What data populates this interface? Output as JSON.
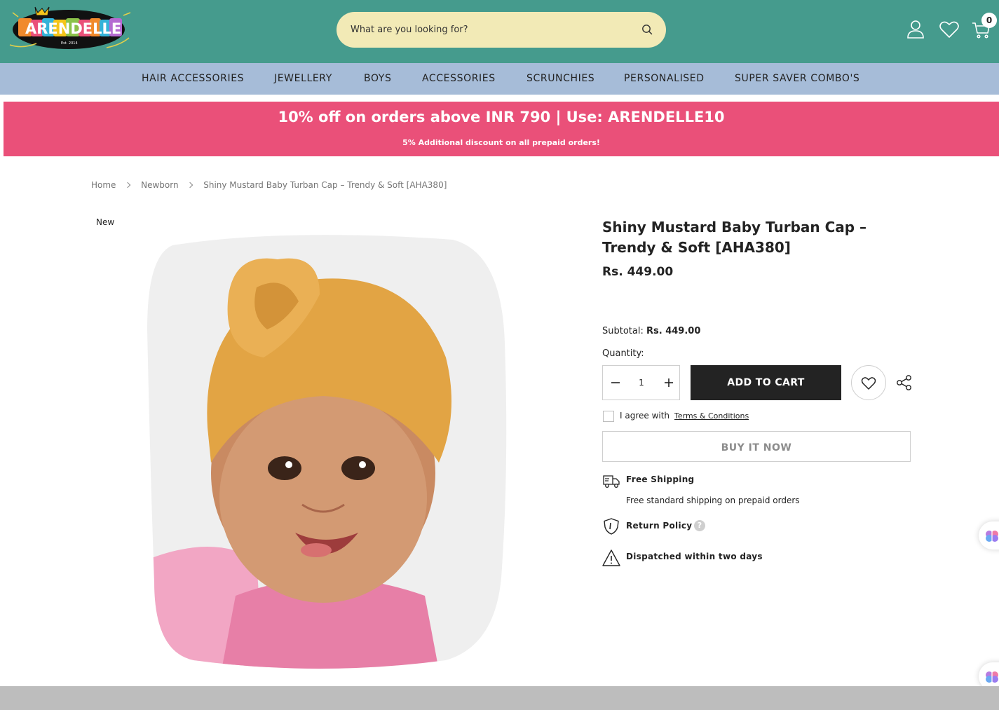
{
  "header": {
    "logo": {
      "name": "ARENDELLE",
      "est": "Est. 2014"
    },
    "search_placeholder": "What are you looking for?",
    "cart_count": "0",
    "colors": {
      "background": "#459b8d",
      "search_bg": "#f2eab6"
    }
  },
  "nav": {
    "items": [
      {
        "label": "HAIR ACCESSORIES"
      },
      {
        "label": "JEWELLERY"
      },
      {
        "label": "BOYS"
      },
      {
        "label": "ACCESSORIES"
      },
      {
        "label": "SCRUNCHIES"
      },
      {
        "label": "PERSONALISED"
      },
      {
        "label": "SUPER SAVER COMBO'S"
      }
    ],
    "background": "#a6bcd8"
  },
  "promo": {
    "main": "10% off on orders above INR 790 | Use: ARENDELLE10",
    "sub": "5% Additional discount on all prepaid orders!",
    "background": "#ea5079"
  },
  "breadcrumb": [
    "Home",
    "Newborn",
    "Shiny Mustard Baby Turban Cap – Trendy & Soft [AHA380]"
  ],
  "product": {
    "badge": "New",
    "title": "Shiny Mustard Baby Turban Cap – Trendy & Soft [AHA380]",
    "price": "Rs. 449.00",
    "subtotal_label": "Subtotal:",
    "subtotal_value": "Rs. 449.00",
    "quantity_label": "Quantity:",
    "quantity_value": "1",
    "add_to_cart": "ADD TO CART",
    "agree_text": "I agree with",
    "terms_link": "Terms & Conditions",
    "buy_now": "BUY IT NOW"
  },
  "features": {
    "shipping_title": "Free Shipping",
    "shipping_sub": "Free standard shipping on prepaid orders",
    "return_title": "Return Policy",
    "dispatch_title": "Dispatched within two days"
  },
  "icons": [
    "search-icon",
    "account-icon",
    "wishlist-icon",
    "cart-icon",
    "minus-icon",
    "plus-icon",
    "heart-icon",
    "share-icon",
    "truck-icon",
    "shield-icon",
    "warning-icon",
    "brain-icon"
  ]
}
